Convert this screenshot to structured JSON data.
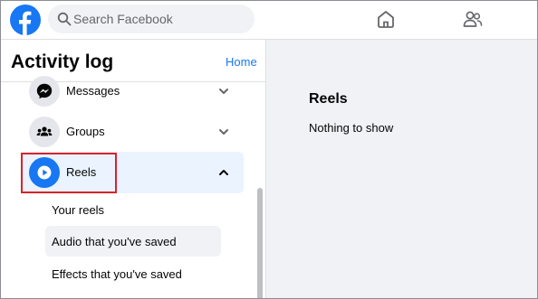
{
  "header": {
    "search": {
      "placeholder": "Search Facebook",
      "value": ""
    }
  },
  "sidebar": {
    "title": "Activity log",
    "home_link": "Home",
    "items": [
      {
        "label": "Messages",
        "icon": "messenger-icon",
        "expanded": false
      },
      {
        "label": "Groups",
        "icon": "groups-icon",
        "expanded": false
      },
      {
        "label": "Reels",
        "icon": "reels-play-icon",
        "expanded": true
      }
    ],
    "sub_items": [
      {
        "label": "Your reels"
      },
      {
        "label": "Audio that you've saved"
      },
      {
        "label": "Effects that you've saved"
      }
    ]
  },
  "main": {
    "section_title": "Reels",
    "empty_text": "Nothing to show"
  },
  "colors": {
    "brand": "#1877f2",
    "active_bg": "#eaf3ff",
    "highlight": "#d9232b",
    "page_bg": "#f0f2f5"
  }
}
